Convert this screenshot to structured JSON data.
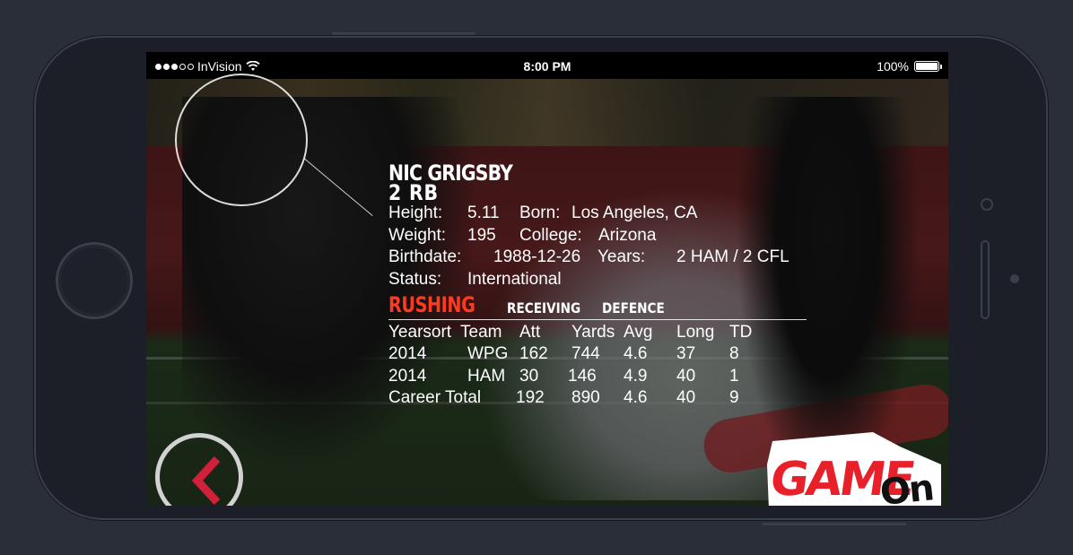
{
  "status_bar": {
    "carrier": "InVision",
    "time": "8:00 PM",
    "battery": "100%"
  },
  "player": {
    "name": "NIC GRIGSBY",
    "number_position": "2  RB",
    "details": {
      "height_label": "Height:",
      "height_value": "5.11",
      "born_label": "Born:",
      "born_value": "Los Angeles, CA",
      "weight_label": "Weight:",
      "weight_value": "195",
      "college_label": "College:",
      "college_value": "Arizona",
      "birthdate_label": "Birthdate:",
      "birthdate_value": "1988-12-26",
      "years_label": "Years:",
      "years_value": "2 HAM / 2 CFL",
      "status_label": "Status:",
      "status_value": "International"
    }
  },
  "tabs": {
    "rushing": "RUSHING",
    "receiving": "RECEIVING",
    "defence": "DEFENCE"
  },
  "stats": {
    "headers": [
      "Yearsort",
      "Team",
      "Att",
      "Yards",
      "Avg",
      "Long",
      "TD"
    ],
    "rows": [
      {
        "year": "2014",
        "team": "WPG",
        "att": "162",
        "yards": "744",
        "avg": "4.6",
        "long": "37",
        "td": "8"
      },
      {
        "year": "2014",
        "team": "HAM",
        "att": "30",
        "yards": "146",
        "avg": "4.9",
        "long": "40",
        "td": "1"
      }
    ],
    "career": {
      "label": "Career Total",
      "att": "192",
      "yards": "890",
      "avg": "4.6",
      "long": "40",
      "td": "9"
    }
  },
  "logo": {
    "text_game": "GAME",
    "text_on": "On"
  },
  "colors": {
    "accent_red": "#ff3b1f",
    "back_arrow": "#d0203a",
    "logo_red": "#e8202a"
  },
  "icons": {
    "back": "chevron-left-icon",
    "wifi": "wifi-icon",
    "battery": "battery-icon"
  }
}
